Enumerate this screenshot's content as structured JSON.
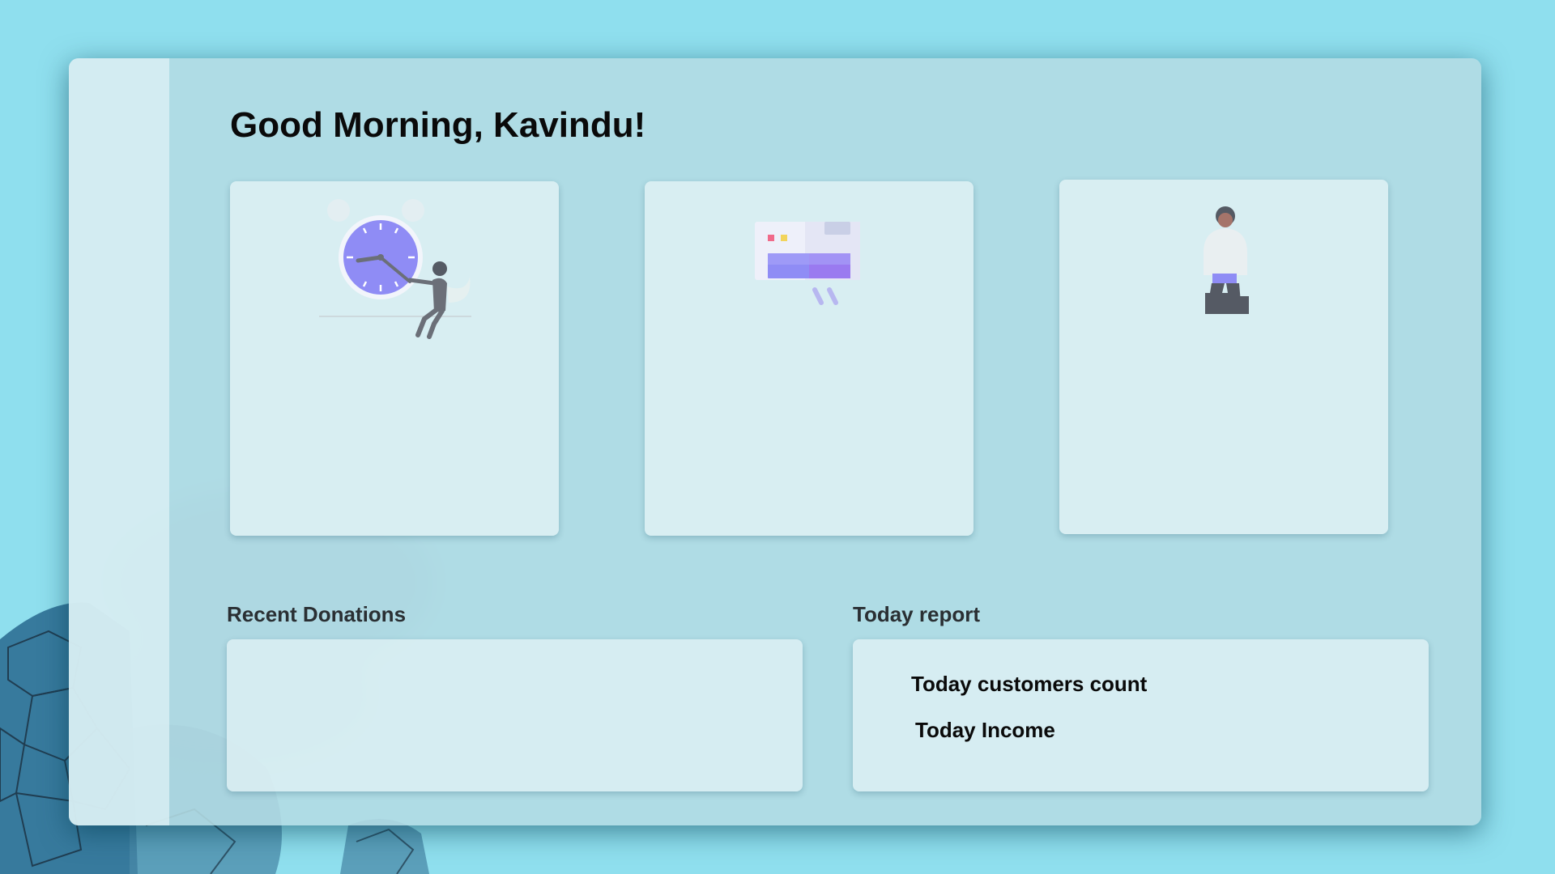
{
  "greeting": "Good Morning, Kavindu!",
  "cards": [
    {
      "illustration": "clock-person-illustration"
    },
    {
      "illustration": "payment-card-illustration"
    },
    {
      "illustration": "standing-person-illustration"
    }
  ],
  "recent_donations": {
    "title": "Recent Donations"
  },
  "today_report": {
    "title": "Today report",
    "customers_label": "Today customers count",
    "income_label": "Today Income"
  },
  "colors": {
    "background": "#8fdfee",
    "accent": "#8f8cf5"
  }
}
